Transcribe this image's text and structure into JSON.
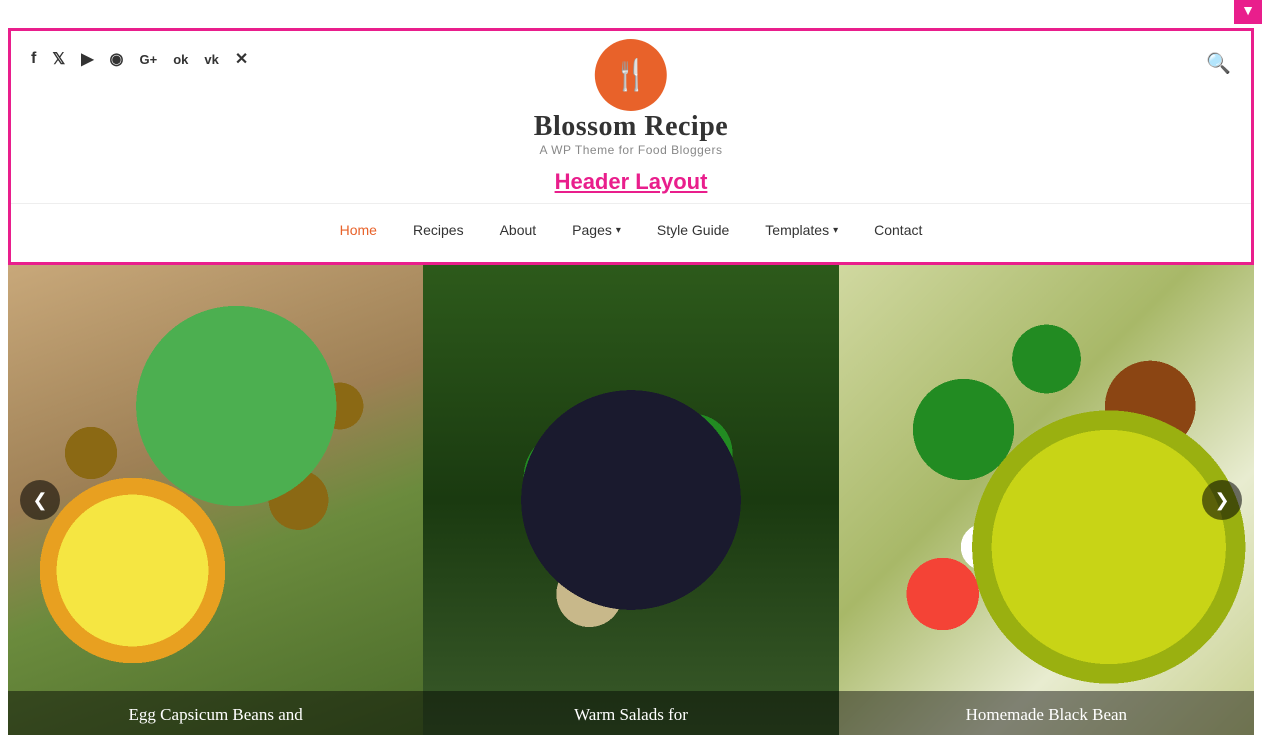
{
  "adminBar": {
    "icon": "▼"
  },
  "header": {
    "logo": {
      "icon": "🍴",
      "title": "Blossom Recipe",
      "subtitle": "A WP Theme for Food Bloggers"
    },
    "layoutLabel": "Header Layout",
    "searchIcon": "🔍"
  },
  "social": {
    "icons": [
      {
        "name": "facebook-icon",
        "symbol": "f"
      },
      {
        "name": "twitter-icon",
        "symbol": "t"
      },
      {
        "name": "youtube-icon",
        "symbol": "▶"
      },
      {
        "name": "instagram-icon",
        "symbol": "📷"
      },
      {
        "name": "google-plus-icon",
        "symbol": "G+"
      },
      {
        "name": "odnoklassniki-icon",
        "symbol": "ok"
      },
      {
        "name": "vk-icon",
        "symbol": "vk"
      },
      {
        "name": "xing-icon",
        "symbol": "✕"
      }
    ]
  },
  "nav": {
    "items": [
      {
        "label": "Home",
        "active": true,
        "hasDropdown": false
      },
      {
        "label": "Recipes",
        "active": false,
        "hasDropdown": false
      },
      {
        "label": "About",
        "active": false,
        "hasDropdown": false
      },
      {
        "label": "Pages",
        "active": false,
        "hasDropdown": true
      },
      {
        "label": "Style Guide",
        "active": false,
        "hasDropdown": false
      },
      {
        "label": "Templates",
        "active": false,
        "hasDropdown": true
      },
      {
        "label": "Contact",
        "active": false,
        "hasDropdown": false
      }
    ]
  },
  "slider": {
    "prevArrow": "❮",
    "nextArrow": "❯",
    "slides": [
      {
        "caption": "Egg Capsicum Beans and"
      },
      {
        "caption": "Warm Salads for"
      },
      {
        "caption": "Homemade Black Bean"
      }
    ]
  }
}
